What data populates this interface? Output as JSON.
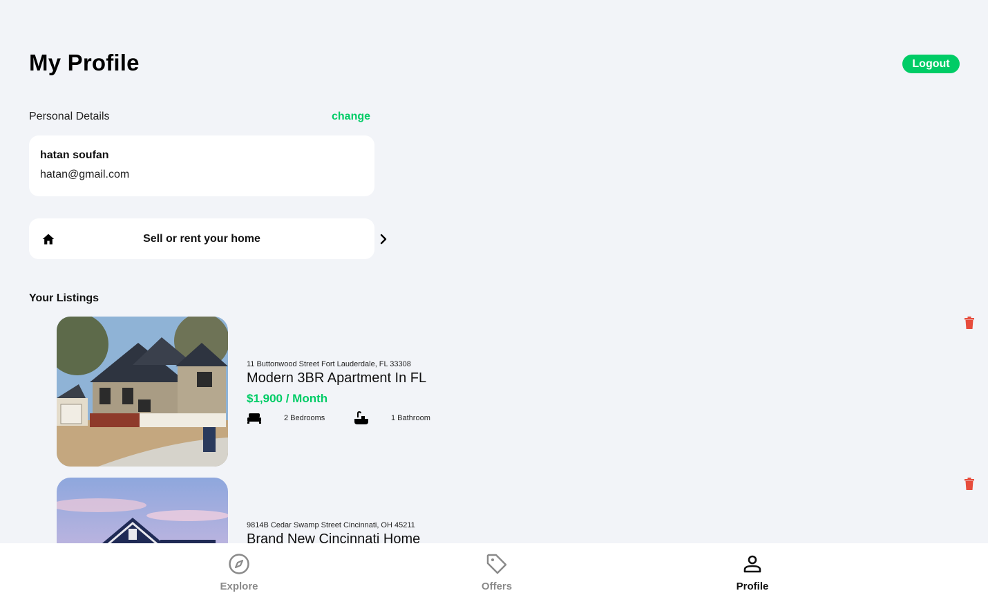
{
  "header": {
    "title": "My Profile",
    "logout_label": "Logout"
  },
  "personal": {
    "label": "Personal Details",
    "change_label": "change",
    "name": "hatan soufan",
    "email": "hatan@gmail.com"
  },
  "sell": {
    "label": "Sell or rent your home",
    "icon": "home-icon",
    "arrow_icon": "chevron-right-icon"
  },
  "listings": {
    "label": "Your Listings",
    "items": [
      {
        "address": "11 Buttonwood Street Fort Lauderdale, FL 33308",
        "name": "Modern 3BR Apartment In FL",
        "price": "$1,900 / Month",
        "bedrooms": "2 Bedrooms",
        "bathrooms": "1 Bathroom"
      },
      {
        "address": "9814B Cedar Swamp Street Cincinnati, OH 45211",
        "name": "Brand New Cincinnati Home"
      }
    ]
  },
  "nav": {
    "items": [
      {
        "label": "Explore",
        "icon": "compass-icon"
      },
      {
        "label": "Offers",
        "icon": "tag-icon"
      },
      {
        "label": "Profile",
        "icon": "person-icon"
      }
    ]
  },
  "colors": {
    "accent": "#00cc66",
    "delete": "#e74c3c",
    "background": "#f2f4f8",
    "nav_inactive": "#8a8a8a"
  }
}
